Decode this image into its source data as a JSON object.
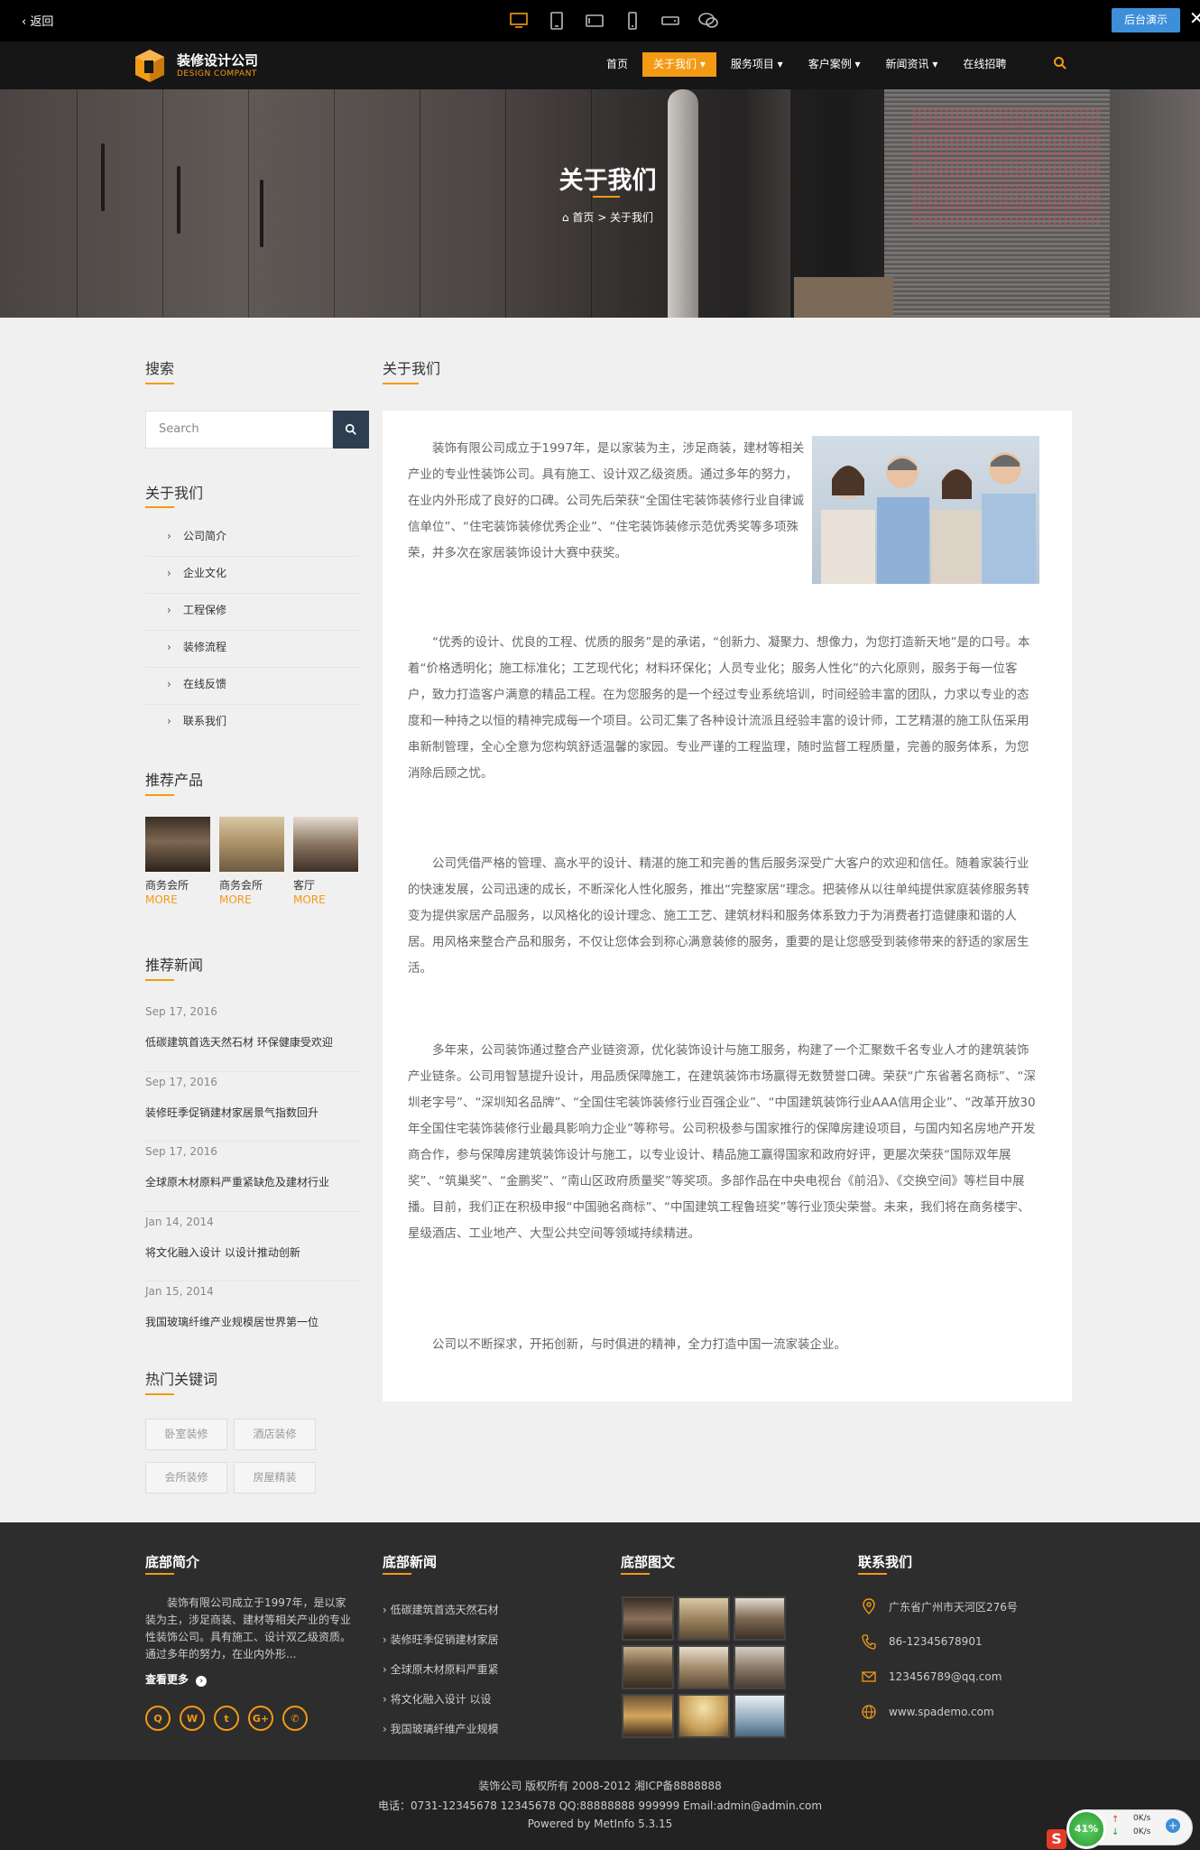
{
  "preview_bar": {
    "back_label": "返回",
    "admin_label": "后台演示",
    "device_icons": [
      "desktop-icon",
      "tablet-portrait-icon",
      "tablet-landscape-icon",
      "phone-portrait-icon",
      "phone-landscape-icon",
      "wechat-icon"
    ]
  },
  "header": {
    "logo_name": "装修设计公司",
    "logo_sub": "DESIGN COMPANT",
    "menu": [
      {
        "label": "首页"
      },
      {
        "label": "关于我们 ▾"
      },
      {
        "label": "服务项目 ▾"
      },
      {
        "label": "客户案例 ▾"
      },
      {
        "label": "新闻资讯 ▾"
      },
      {
        "label": "在线招聘"
      }
    ]
  },
  "banner": {
    "title": "关于我们",
    "breadcrumb": "首页 > 关于我们"
  },
  "sidebar": {
    "search_title": "搜索",
    "search_placeholder": "Search",
    "about_title": "关于我们",
    "about_items": [
      "公司简介",
      "企业文化",
      "工程保修",
      "装修流程",
      "在线反馈",
      "联系我们"
    ],
    "products_title": "推荐产品",
    "products": [
      {
        "name": "商务会所",
        "more": "MORE"
      },
      {
        "name": "商务会所",
        "more": "MORE"
      },
      {
        "name": "客厅",
        "more": "MORE"
      }
    ],
    "news_title": "推荐新闻",
    "news": [
      {
        "date": "Sep 17, 2016",
        "title": "低碳建筑首选天然石材 环保健康受欢迎"
      },
      {
        "date": "Sep 17, 2016",
        "title": "装修旺季促销建材家居景气指数回升"
      },
      {
        "date": "Sep 17, 2016",
        "title": "全球原木材原料严重紧缺危及建材行业"
      },
      {
        "date": "Jan 14, 2014",
        "title": "将文化融入设计 以设计推动创新"
      },
      {
        "date": "Jan 15, 2014",
        "title": "我国玻璃纤维产业规模居世界第一位"
      }
    ],
    "keywords_title": "热门关键词",
    "keywords": [
      "卧室装修",
      "酒店装修",
      "会所装修",
      "房屋精装"
    ]
  },
  "main": {
    "title": "关于我们",
    "paragraphs": [
      "装饰有限公司成立于1997年，是以家装为主，涉足商装，建材等相关产业的专业性装饰公司。具有施工、设计双乙级资质。通过多年的努力，在业内外形成了良好的口碑。公司先后荣获“全国住宅装饰装修行业自律诚信单位”、“住宅装饰装修优秀企业”、“住宅装饰装修示范优秀奖等多项殊荣，并多次在家居装饰设计大赛中获奖。",
      "“优秀的设计、优良的工程、优质的服务”是的承诺，“创新力、凝聚力、想像力，为您打造新天地”是的口号。本着“价格透明化；施工标准化；工艺现代化；材料环保化；人员专业化；服务人性化”的六化原则，服务于每一位客户，致力打造客户满意的精品工程。在为您服务的是一个经过专业系统培训，时间经验丰富的团队，力求以专业的态度和一种持之以恒的精神完成每一个项目。公司汇集了各种设计流派且经验丰富的设计师，工艺精湛的施工队伍采用串新制管理，全心全意为您构筑舒适温馨的家园。专业严谨的工程监理，随时监督工程质量，完善的服务体系，为您消除后顾之忧。",
      "公司凭借严格的管理、高水平的设计、精湛的施工和完善的售后服务深受广大客户的欢迎和信任。随着家装行业的快速发展，公司迅速的成长，不断深化人性化服务，推出“完整家居”理念。把装修从以往单纯提供家庭装修服务转变为提供家居产品服务，以风格化的设计理念、施工工艺、建筑材料和服务体系致力于为消费者打造健康和谐的人居。用风格来整合产品和服务，不仅让您体会到称心满意装修的服务，重要的是让您感受到装修带来的舒适的家居生活。",
      "多年来，公司装饰通过整合产业链资源，优化装饰设计与施工服务，构建了一个汇聚数千名专业人才的建筑装饰产业链条。公司用智慧提升设计，用品质保障施工，在建筑装饰市场赢得无数赞誉口碑。荣获“广东省著名商标”、“深圳老字号”、“深圳知名品牌”、“全国住宅装饰装修行业百强企业”、“中国建筑装饰行业AAA信用企业”、“改革开放30年全国住宅装饰装修行业最具影响力企业”等称号。公司积极参与国家推行的保障房建设项目，与国内知名房地产开发商合作，参与保障房建筑装饰设计与施工，以专业设计、精品施工赢得国家和政府好评，更屡次荣获“国际双年展奖”、“筑巢奖”、“金鹏奖”、“南山区政府质量奖”等奖项。多部作品在中央电视台《前沿》、《交换空间》等栏目中展播。目前，我们正在积极申报“中国驰名商标”、“中国建筑工程鲁班奖”等行业顶尖荣誉。未来，我们将在商务楼宇、星级酒店、工业地产、大型公共空间等领域持续精进。",
      "公司以不断探求，开拓创新，与时俱进的精神，全力打造中国一流家装企业。"
    ]
  },
  "footer": {
    "intro_title": "底部简介",
    "intro_text": "装饰有限公司成立于1997年，是以家装为主，涉足商装、建材等相关产业的专业性装饰公司。具有施工、设计双乙级资质。通过多年的努力，在业内外形...",
    "more_label": "查看更多",
    "socials": [
      "qq-icon",
      "weibo-icon",
      "twitter-icon",
      "google-plus-icon",
      "wechat-icon"
    ],
    "news_title": "底部新闻",
    "news": [
      "低碳建筑首选天然石材",
      "装修旺季促销建材家居",
      "全球原木材原料严重紧",
      "将文化融入设计 以设",
      "我国玻璃纤维产业规模"
    ],
    "gallery_title": "底部图文",
    "contact_title": "联系我们",
    "contacts": [
      {
        "icon": "location-icon",
        "text": "广东省广州市天河区276号"
      },
      {
        "icon": "phone-icon",
        "text": "86-12345678901"
      },
      {
        "icon": "mail-icon",
        "text": "123456789@qq.com"
      },
      {
        "icon": "globe-icon",
        "text": "www.spademo.com"
      }
    ]
  },
  "copyright": {
    "line1": "装饰公司 版权所有 2008-2012 湘ICP备8888888",
    "line2": "电话：0731-12345678 12345678 QQ:88888888 999999 Email:admin@admin.com",
    "line3": "Powered by MetInfo 5.3.15"
  },
  "speed_widget": {
    "percent": "41%",
    "up": "0K/s",
    "down": "0K/s"
  },
  "colors": {
    "accent": "#f39a14",
    "nav_bg": "#161616",
    "footer_bg": "#2d2d2d",
    "admin_btn": "#3d8fd9"
  }
}
